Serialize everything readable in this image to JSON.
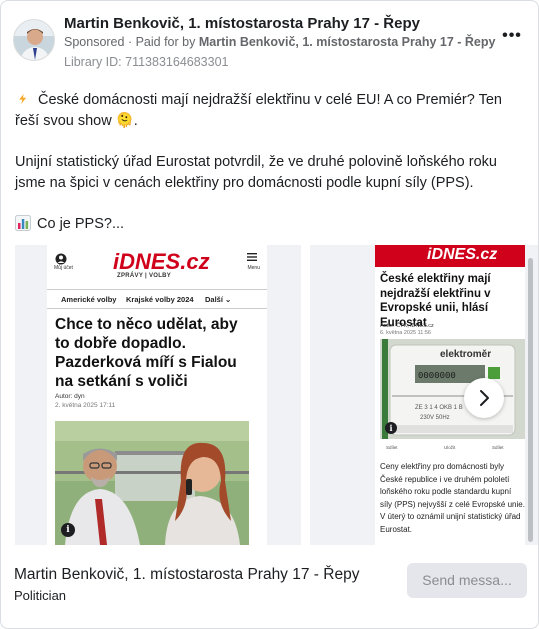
{
  "post": {
    "page_name": "Martin Benkovič, 1. místostarosta Prahy 17 - Řepy",
    "sponsored_label": "Sponsored",
    "paid_for_prefix": "Paid for by",
    "paid_for_name": "Martin Benkovič, 1. místostarosta Prahy 17 - Řepy",
    "library_id": "Library ID: 711383164683301",
    "more_icon": "more-horizontal-icon",
    "more_glyph": "•••"
  },
  "body": {
    "line1": "České domácnosti mají nejdražší elektřinu v celé EU! A co Premiér? Ten řeší svou show 🫠.",
    "line2": "Unijní statistický úřad Eurostat potvrdil, že ve druhé polovině loňského roku jsme na špici v cenách elektřiny pro domácnosti podle kupní síly (PPS).",
    "line3": "Co je PPS?...",
    "emoji1": "lightning-emoji",
    "emoji2": "bar-chart-emoji"
  },
  "slide1": {
    "logo": "iDNES.cz",
    "menu_label": "Můj účet",
    "menu_label2": "Menu",
    "subnav": "ZPRÁVY  |  VOLBY",
    "tab1": "Americké volby",
    "tab2": "Krajské volby 2024",
    "tab3": "Další ⌄",
    "headline": "Chce to něco udělat, aby to dobře dopadlo. Pazderková míří s Fialou na setkání s voliči",
    "author": "Autor: dyn",
    "date": "2. května 2025  17:11",
    "info_glyph": "i"
  },
  "slide2": {
    "logo": "iDNES.cz",
    "headline": "České elektřiny mají nejdražší elektřinu v Evropské unii, hlásí Eurostat",
    "author": "Autor: ČTK, iDNES.cz",
    "date": "6. května 2025  11:56",
    "meter_text": "elektroměr",
    "action1": "Sdílet",
    "action2": "Uložit",
    "action3": "Sdílet",
    "text": "Ceny elektřiny pro domácnosti byly České republice i ve druhém pololetí loňského roku podle standardu kupní síly (PPS) nejvyšší z celé Evropské unie. V úterý to oznámil unijní statistický úřad Eurostat.",
    "info_glyph": "i"
  },
  "footer": {
    "name": "Martin Benkovič, 1. místostarosta Prahy 17 - Řepy",
    "role": "Politician",
    "send_label": "Send messa..."
  },
  "colors": {
    "idnes_red": "#d0021b",
    "button_bg": "#e4e6eb",
    "muted_text": "#65676b"
  }
}
